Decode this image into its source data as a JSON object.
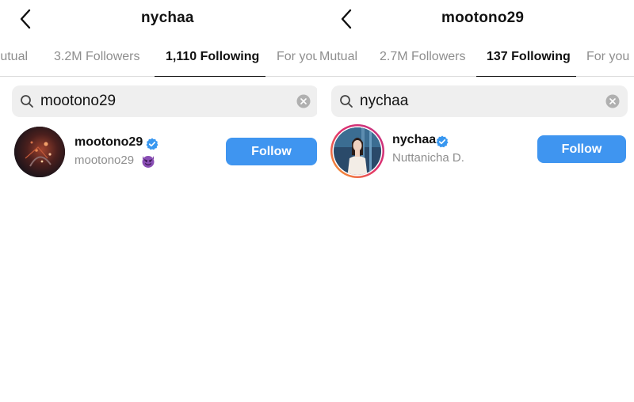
{
  "left": {
    "title": "nychaa",
    "tabs": [
      "Mutual",
      "3.2M Followers",
      "1,110 Following",
      "For you"
    ],
    "active_tab": "1,110 Following",
    "search_value": "mootono29",
    "result": {
      "username": "mootono29",
      "subname": "mootono29",
      "verified": true,
      "emoji_icon": "smiling-devil-emoji",
      "follow_label": "Follow"
    }
  },
  "right": {
    "title": "mootono29",
    "tabs": [
      "Mutual",
      "2.7M Followers",
      "137 Following",
      "For you"
    ],
    "active_tab": "137 Following",
    "search_value": "nychaa",
    "result": {
      "username": "nychaa",
      "subname": "Nuttanicha D.",
      "verified": true,
      "story_ring": true,
      "follow_label": "Follow"
    }
  },
  "colors": {
    "follow_button": "#3f95f0",
    "verified": "#3897f0",
    "search_bg": "#efefef",
    "secondary_text": "#8e8e8e"
  }
}
